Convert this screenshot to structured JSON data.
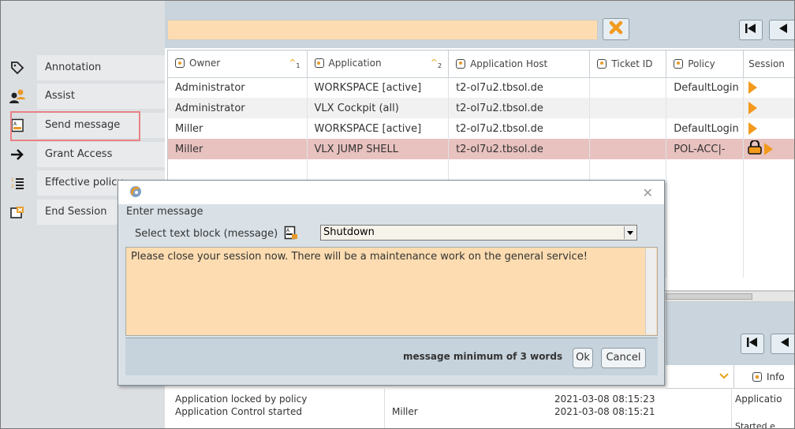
{
  "sidebar": {
    "items": [
      {
        "label": "Annotation",
        "icon": "tag-icon"
      },
      {
        "label": "Assist",
        "icon": "users-icon"
      },
      {
        "label": "Send message",
        "icon": "message-icon"
      },
      {
        "label": "Grant Access",
        "icon": "arrow-right-icon"
      },
      {
        "label": "Effective policy",
        "icon": "numbered-list-icon"
      },
      {
        "label": "End Session",
        "icon": "end-session-icon"
      }
    ]
  },
  "table": {
    "headers": [
      "Owner",
      "Application",
      "Application Host",
      "Ticket ID",
      "Policy",
      "Session"
    ],
    "sort_markers": [
      "1",
      "2"
    ],
    "rows": [
      {
        "owner": "Administrator",
        "application": "WORKSPACE [active]",
        "host": "t2-ol7u2.tbsol.de",
        "ticket": "",
        "policy": "DefaultLogin"
      },
      {
        "owner": "Administrator",
        "application": "VLX Cockpit (all)",
        "host": "t2-ol7u2.tbsol.de",
        "ticket": "",
        "policy": ""
      },
      {
        "owner": "Miller",
        "application": "WORKSPACE [active]",
        "host": "t2-ol7u2.tbsol.de",
        "ticket": "",
        "policy": "DefaultLogin"
      },
      {
        "owner": "Miller",
        "application": "VLX JUMP SHELL",
        "host": "t2-ol7u2.tbsol.de",
        "ticket": "",
        "policy": "POL-ACC|-"
      }
    ]
  },
  "log": {
    "header_info": "Info",
    "rows": [
      {
        "message": "Application locked by policy",
        "user": "",
        "time": "2021-03-08 08:15:23",
        "info": "Applicatio"
      },
      {
        "message": "Application Control started",
        "user": "Miller",
        "time": "2021-03-08 08:15:21",
        "info": ""
      },
      {
        "message": "",
        "user": "",
        "time": "",
        "info": "Started e"
      }
    ]
  },
  "dialog": {
    "heading": "Enter message",
    "select_label": "Select text block (message)",
    "selected_block": "Shutdown",
    "message_text": "Please close your session now. There will be a maintenance work on the general service!",
    "hint": "message minimum of 3 words",
    "ok_label": "Ok",
    "cancel_label": "Cancel"
  },
  "colors": {
    "accent_orange": "#f39a1d",
    "input_bg": "#fcdcb0",
    "selected_row": "#e8c2bf",
    "highlight_box": "#e88286"
  }
}
